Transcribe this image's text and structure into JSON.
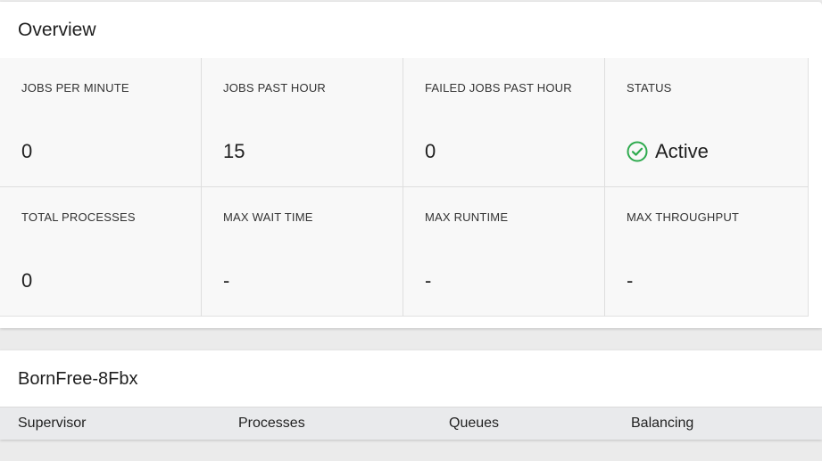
{
  "overview": {
    "title": "Overview",
    "stats": [
      {
        "label": "Jobs Per Minute",
        "value": "0"
      },
      {
        "label": "Jobs Past Hour",
        "value": "15"
      },
      {
        "label": "Failed Jobs Past Hour",
        "value": "0"
      },
      {
        "label": "Status",
        "value": "Active",
        "icon": "check-circle-icon",
        "color": "#2eaa4e"
      },
      {
        "label": "Total Processes",
        "value": "0"
      },
      {
        "label": "Max Wait Time",
        "value": "-"
      },
      {
        "label": "Max Runtime",
        "value": "-"
      },
      {
        "label": "Max Throughput",
        "value": "-"
      }
    ]
  },
  "supervisor": {
    "title": "BornFree-8Fbx",
    "columns": [
      "Supervisor",
      "Processes",
      "Queues",
      "Balancing"
    ]
  }
}
